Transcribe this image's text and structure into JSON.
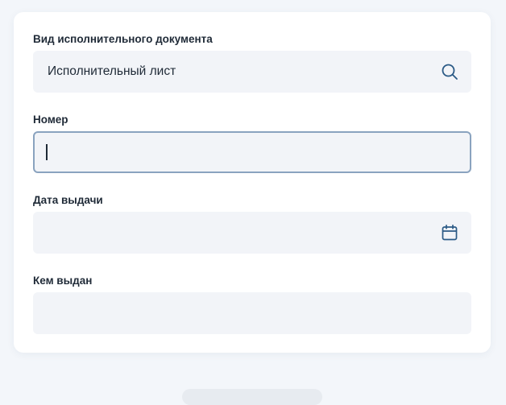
{
  "form": {
    "doc_type": {
      "label": "Вид исполнительного документа",
      "value": "Исполнительный лист",
      "icon": "search-icon"
    },
    "number": {
      "label": "Номер",
      "value": ""
    },
    "issue_date": {
      "label": "Дата выдачи",
      "value": "",
      "icon": "calendar-icon"
    },
    "issued_by": {
      "label": "Кем выдан",
      "value": ""
    }
  },
  "colors": {
    "page_bg": "#f3f6fa",
    "card_bg": "#ffffff",
    "field_bg": "#f2f4f8",
    "focus_border": "#8aa3bf",
    "icon_color": "#2b5a86",
    "text": "#1f2a37"
  }
}
